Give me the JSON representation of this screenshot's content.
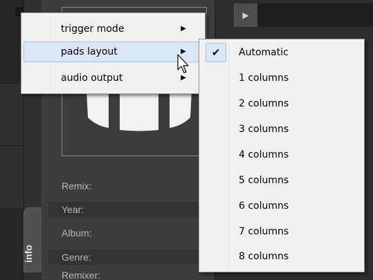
{
  "info_tab": {
    "label": "info"
  },
  "track_fields": [
    {
      "label": "Remix:"
    },
    {
      "label": "Year:"
    },
    {
      "label": "Album:"
    },
    {
      "label": "Genre:"
    },
    {
      "label": "Remixer:"
    }
  ],
  "toolbar": {
    "play_icon": "play-icon"
  },
  "context_menu": {
    "items": [
      {
        "label": "trigger mode",
        "has_submenu": true
      },
      {
        "label": "pads layout",
        "has_submenu": true,
        "highlighted": true
      },
      {
        "label": "audio output",
        "has_submenu": true
      }
    ]
  },
  "pads_layout_submenu": {
    "items": [
      {
        "label": "Automatic",
        "checked": true
      },
      {
        "label": "1 columns"
      },
      {
        "label": "2 columns"
      },
      {
        "label": "3 columns"
      },
      {
        "label": "4 columns"
      },
      {
        "label": "5 columns"
      },
      {
        "label": "6 columns"
      },
      {
        "label": "7 columns"
      },
      {
        "label": "8 columns"
      }
    ]
  },
  "colors": {
    "menu_background": "#f0f0f0",
    "menu_highlight": "#dbe7f6",
    "menu_highlight_border": "#a8c4e6",
    "app_background": "#3a3a3a"
  }
}
